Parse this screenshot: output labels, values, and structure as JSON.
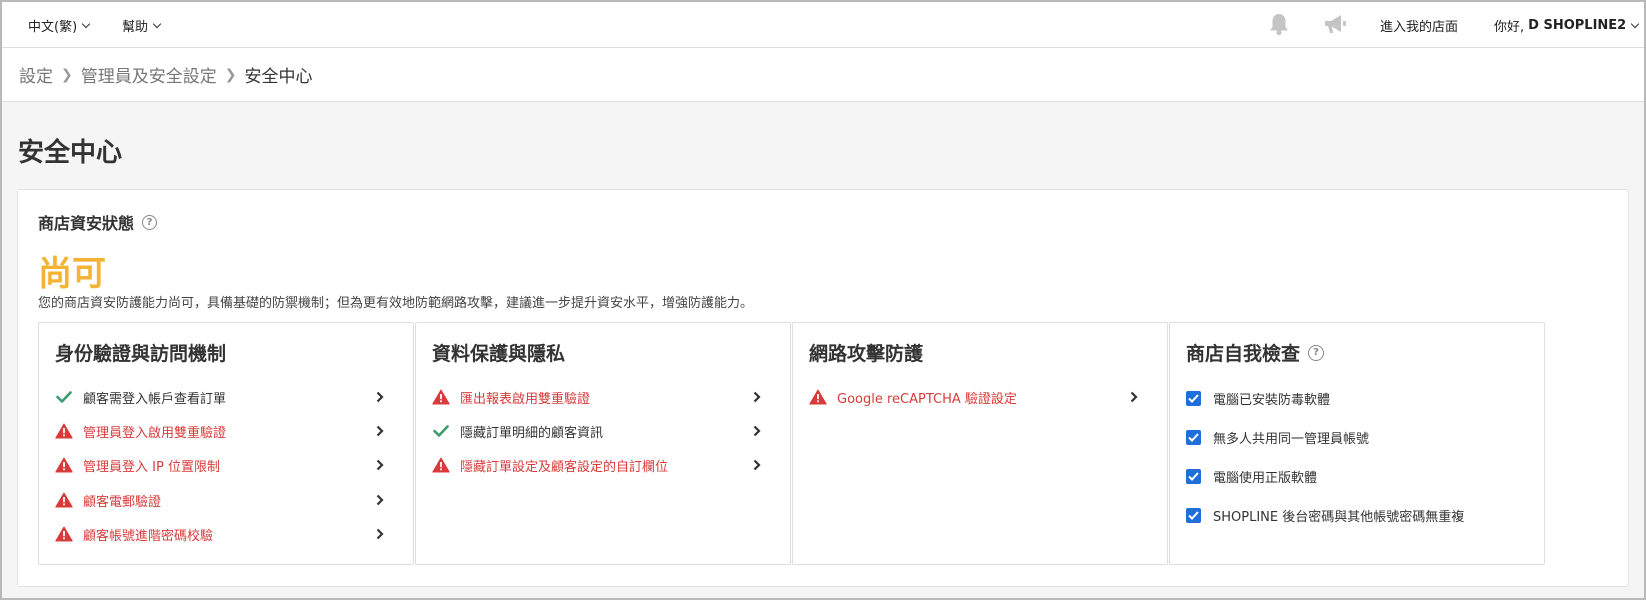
{
  "topbar": {
    "language": "中文(繁)",
    "help": "幫助",
    "store_link": "進入我的店面",
    "greeting": "你好,",
    "user_name": "D SHOPLINE2"
  },
  "breadcrumb": {
    "items": [
      "設定",
      "管理員及安全設定"
    ],
    "current": "安全中心"
  },
  "page": {
    "title": "安全中心"
  },
  "status": {
    "title": "商店資安狀態",
    "level": "尚可",
    "description": "您的商店資安防護能力尚可，具備基礎的防禦機制；但為更有效地防範網路攻擊，建議進一步提升資安水平，增強防護能力。"
  },
  "cards": [
    {
      "title": "身份驗證與訪問機制",
      "items": [
        {
          "label": "顧客需登入帳戶查看訂單",
          "state": "ok"
        },
        {
          "label": "管理員登入啟用雙重驗證",
          "state": "warn"
        },
        {
          "label": "管理員登入 IP 位置限制",
          "state": "warn"
        },
        {
          "label": "顧客電郵驗證",
          "state": "warn"
        },
        {
          "label": "顧客帳號進階密碼校驗",
          "state": "warn"
        }
      ]
    },
    {
      "title": "資料保護與隱私",
      "items": [
        {
          "label": "匯出報表啟用雙重驗證",
          "state": "warn"
        },
        {
          "label": "隱藏訂單明細的顧客資訊",
          "state": "ok"
        },
        {
          "label": "隱藏訂單設定及顧客設定的自訂欄位",
          "state": "warn"
        }
      ]
    },
    {
      "title": "網路攻擊防護",
      "items": [
        {
          "label": "Google reCAPTCHA 驗證設定",
          "state": "warn"
        }
      ]
    }
  ],
  "self_check": {
    "title": "商店自我檢查",
    "items": [
      {
        "label": "電腦已安裝防毒軟體",
        "checked": true
      },
      {
        "label": "無多人共用同一管理員帳號",
        "checked": true
      },
      {
        "label": "電腦使用正版軟體",
        "checked": true
      },
      {
        "label": "SHOPLINE 後台密碼與其他帳號密碼無重複",
        "checked": true
      }
    ]
  },
  "colors": {
    "warning": "#d93b3b",
    "ok": "#3a9d6f",
    "status_level": "#f5b335",
    "checkbox": "#1e6fd9"
  },
  "icons": {
    "ok": "check-icon",
    "warn": "warning-triangle-icon",
    "arrow": "chevron-right-icon"
  }
}
